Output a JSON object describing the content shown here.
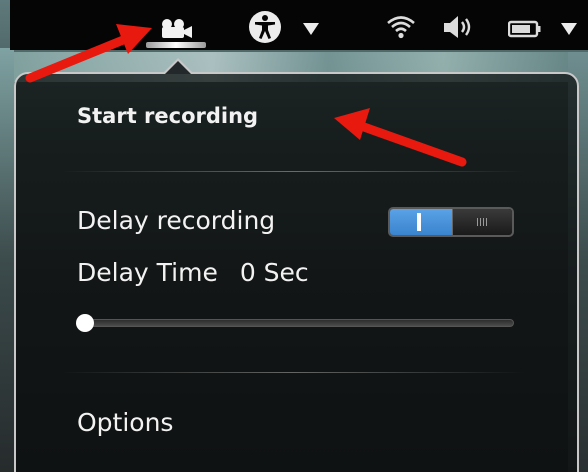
{
  "topbar": {
    "icons": [
      {
        "name": "screen-recorder-icon"
      },
      {
        "name": "accessibility-icon"
      },
      {
        "name": "accessibility-menu-arrow-icon"
      },
      {
        "name": "wifi-icon"
      },
      {
        "name": "volume-icon"
      },
      {
        "name": "battery-icon"
      },
      {
        "name": "battery-menu-arrow-icon"
      }
    ]
  },
  "menu": {
    "start_recording": "Start recording",
    "delay_recording_label": "Delay recording",
    "delay_recording_enabled": true,
    "delay_time_label": "Delay Time",
    "delay_time_value": "0 Sec",
    "delay_slider_fraction": 0.0,
    "options_label": "Options"
  },
  "annotations": {
    "arrow_color": "#e8190f"
  },
  "colors": {
    "toggle_on": "#4a93dc",
    "panel_border": "#c8c8c8",
    "topbar_bg": "#050505"
  }
}
